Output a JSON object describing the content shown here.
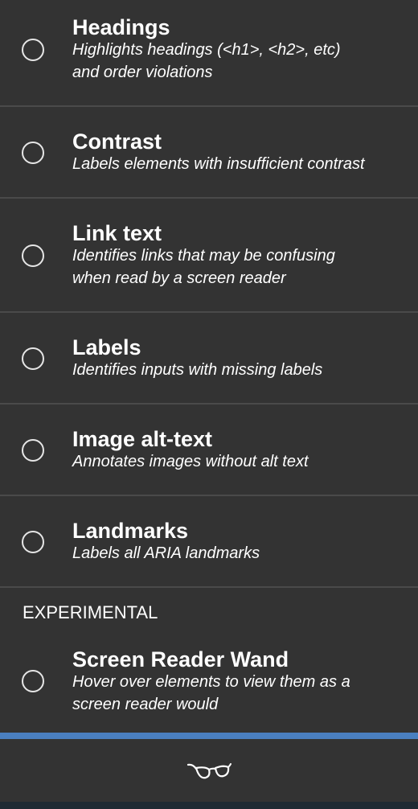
{
  "plugins": [
    {
      "title": "Headings",
      "description_line1": "Highlights headings (<h1>, <h2>, etc)",
      "description_line2": "and order violations"
    },
    {
      "title": "Contrast",
      "description_line1": "Labels elements with insufficient contrast",
      "description_line2": ""
    },
    {
      "title": "Link text",
      "description_line1": "Identifies links that may be confusing",
      "description_line2": "when read by a screen reader"
    },
    {
      "title": "Labels",
      "description_line1": "Identifies inputs with missing labels",
      "description_line2": ""
    },
    {
      "title": "Image alt-text",
      "description_line1": "Annotates images without alt text",
      "description_line2": ""
    },
    {
      "title": "Landmarks",
      "description_line1": "Labels all ARIA landmarks",
      "description_line2": ""
    }
  ],
  "experimental": {
    "section_label": "EXPERIMENTAL",
    "plugin": {
      "title": "Screen Reader Wand",
      "description_line1": "Hover over elements to view them as a",
      "description_line2": "screen reader would"
    }
  },
  "footer": {
    "icon": "glasses-icon",
    "accent_color": "#4a7fc0"
  },
  "colors": {
    "background": "#333333",
    "divider": "#4a4a4a",
    "text": "#ffffff"
  }
}
